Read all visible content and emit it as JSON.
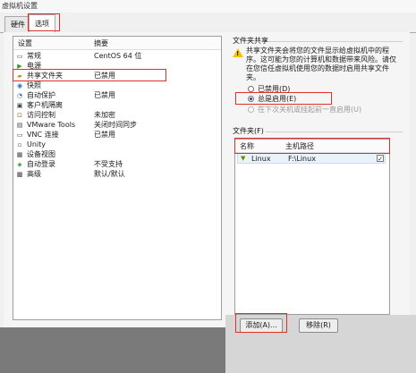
{
  "window": {
    "title": "虚拟机设置"
  },
  "tabs": [
    {
      "label": "硬件"
    },
    {
      "label": "选项"
    }
  ],
  "settings": {
    "col_setting": "设置",
    "col_summary": "摘要",
    "items": [
      {
        "name": "常规",
        "summary": "CentOS 64 位",
        "icon": "general-icon"
      },
      {
        "name": "电源",
        "summary": "",
        "icon": "power-icon"
      },
      {
        "name": "共享文件夹",
        "summary": "已禁用",
        "icon": "shared-folder-icon"
      },
      {
        "name": "快照",
        "summary": "",
        "icon": "snapshot-icon"
      },
      {
        "name": "自动保护",
        "summary": "已禁用",
        "icon": "autoprotect-icon"
      },
      {
        "name": "客户机隔离",
        "summary": "",
        "icon": "isolation-icon"
      },
      {
        "name": "访问控制",
        "summary": "未加密",
        "icon": "lock-icon"
      },
      {
        "name": "VMware Tools",
        "summary": "关闭时间同步",
        "icon": "tools-icon"
      },
      {
        "name": "VNC 连接",
        "summary": "已禁用",
        "icon": "vnc-icon"
      },
      {
        "name": "Unity",
        "summary": "",
        "icon": "unity-icon"
      },
      {
        "name": "设备视图",
        "summary": "",
        "icon": "device-view-icon"
      },
      {
        "name": "自动登录",
        "summary": "不受支持",
        "icon": "autologin-icon"
      },
      {
        "name": "高级",
        "summary": "默认/默认",
        "icon": "advanced-icon"
      }
    ]
  },
  "sharing": {
    "group_label": "文件夹共享",
    "info": "共享文件夹会将您的文件显示给虚拟机中的程序。这可能为您的计算机和数据带来风险。请仅在您信任虚拟机使用您的数据时启用共享文件夹。",
    "options": [
      {
        "label": "已禁用(D)",
        "selected": false,
        "disabled": false
      },
      {
        "label": "总是启用(E)",
        "selected": true,
        "disabled": false
      },
      {
        "label": "在下次关机或挂起前一直启用(U)",
        "selected": false,
        "disabled": true
      }
    ]
  },
  "folders": {
    "group_label": "文件夹(F)",
    "col_name": "名称",
    "col_path": "主机路径",
    "rows": [
      {
        "name": "Linux",
        "path": "F:\\Linux",
        "checked": true
      }
    ],
    "add_button": "添加(A)...",
    "remove_button": "移除(R)"
  },
  "colors": {
    "highlight_box": "#e0302a",
    "warning": "#f2c40f"
  }
}
